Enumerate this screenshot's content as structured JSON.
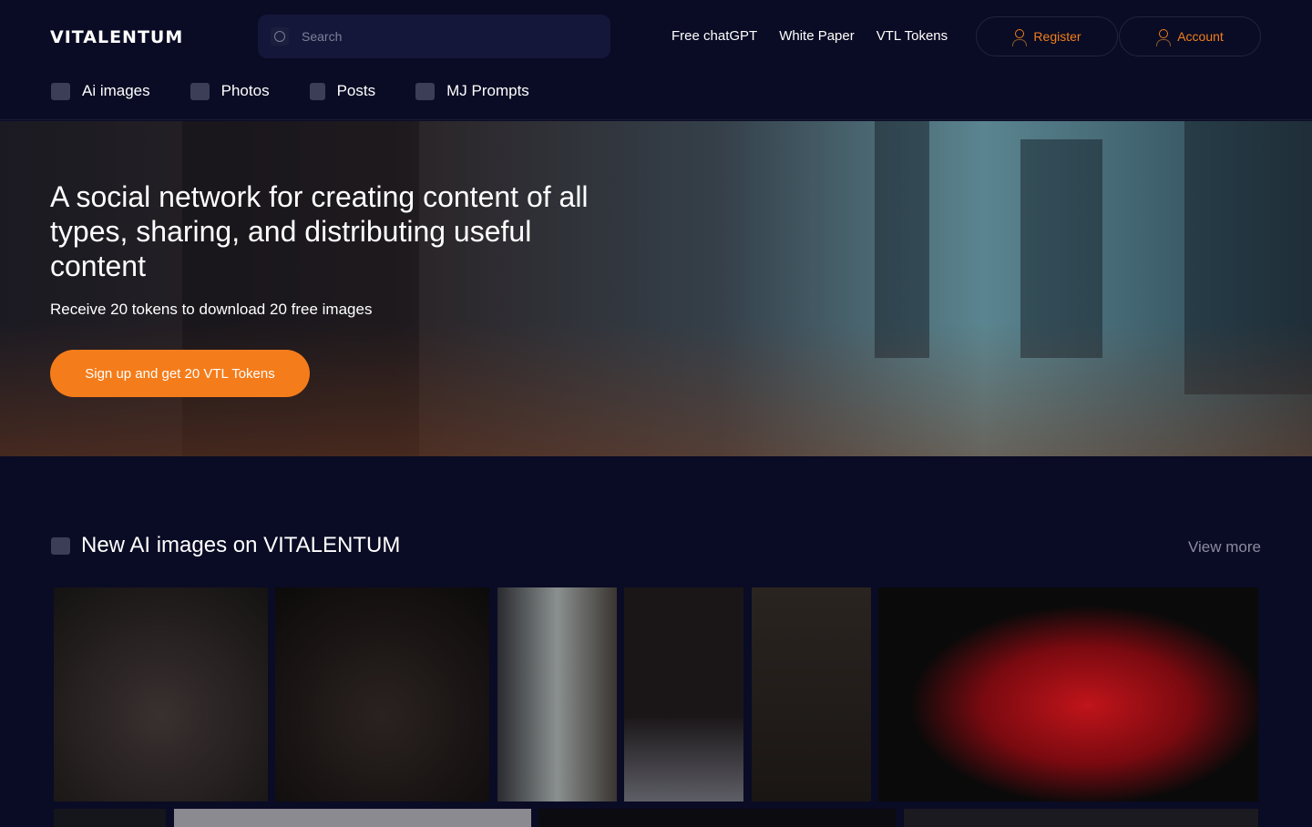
{
  "header": {
    "logo": "VITALENTUM",
    "search_placeholder": "Search",
    "links": [
      "Free chatGPT",
      "White Paper",
      "VTL Tokens"
    ],
    "register": "Register",
    "account": "Account"
  },
  "nav": [
    {
      "label": "Ai images",
      "icon": "image-icon"
    },
    {
      "label": "Photos",
      "icon": "camera-icon"
    },
    {
      "label": "Posts",
      "icon": "document-icon"
    },
    {
      "label": "MJ Prompts",
      "icon": "chart-icon"
    }
  ],
  "hero": {
    "title": "A social network for creating content of all types, sharing, and distributing useful content",
    "subtitle": "Receive 20 tokens to download 20 free images",
    "cta": "Sign up and get 20 VTL Tokens"
  },
  "section": {
    "title": "New AI images on VITALENTUM",
    "view_more": "View more"
  },
  "colors": {
    "accent": "#f57c1a",
    "background": "#0a0b24"
  }
}
